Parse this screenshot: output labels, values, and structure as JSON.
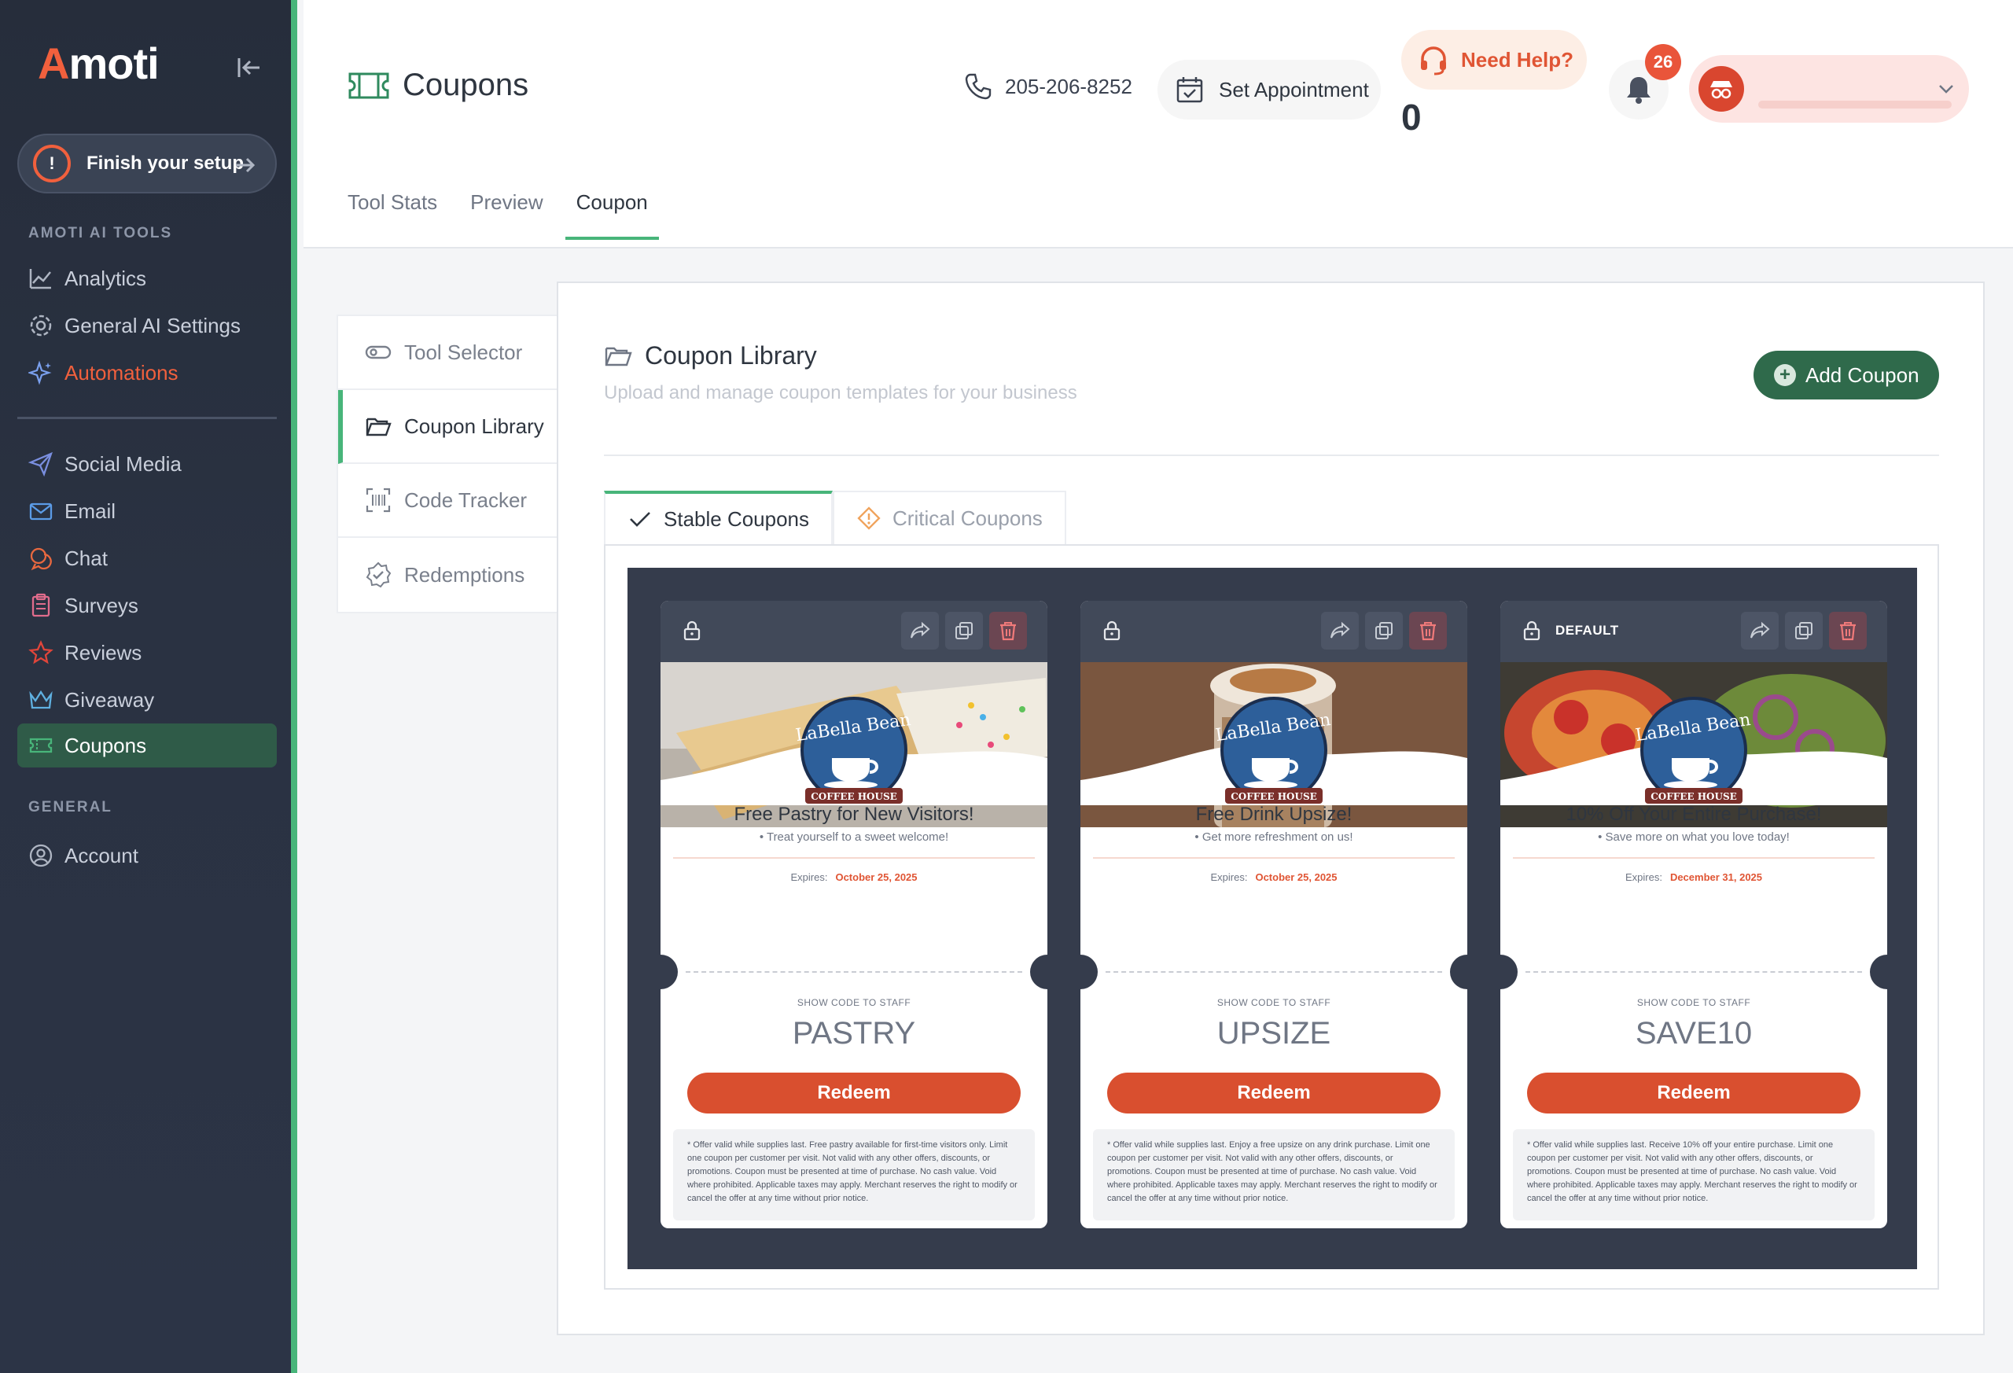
{
  "brand": {
    "logo": "Amoti"
  },
  "sidebar": {
    "setup_label": "Finish your setup",
    "section_tools": "AMOTI AI TOOLS",
    "tools": [
      {
        "label": "Analytics",
        "icon": "chart-line-icon"
      },
      {
        "label": "General AI Settings",
        "icon": "gear-icon"
      },
      {
        "label": "Automations",
        "icon": "sparkle-icon"
      }
    ],
    "items": [
      {
        "label": "Social Media",
        "icon": "send-icon"
      },
      {
        "label": "Email",
        "icon": "mail-icon"
      },
      {
        "label": "Chat",
        "icon": "chat-icon"
      },
      {
        "label": "Surveys",
        "icon": "clipboard-icon"
      },
      {
        "label": "Reviews",
        "icon": "star-icon"
      },
      {
        "label": "Giveaway",
        "icon": "crown-icon"
      },
      {
        "label": "Coupons",
        "icon": "ticket-icon"
      }
    ],
    "section_general": "GENERAL",
    "account": "Account"
  },
  "header": {
    "title": "Coupons",
    "phone": "205-206-8252",
    "appointment": "Set Appointment",
    "help": "Need Help?",
    "help_count": "0",
    "notifications": "26",
    "tabs": [
      "Tool Stats",
      "Preview",
      "Coupon"
    ],
    "active_tab": "Coupon"
  },
  "subnav": {
    "items": [
      "Tool Selector",
      "Coupon Library",
      "Code Tracker",
      "Redemptions"
    ],
    "active": "Coupon Library"
  },
  "library": {
    "title": "Coupon Library",
    "subtitle": "Upload and manage coupon templates for your business",
    "add_button": "Add Coupon",
    "tabs": [
      "Stable Coupons",
      "Critical Coupons"
    ],
    "active_tab": "Stable Coupons"
  },
  "coupons": [
    {
      "default_label": "",
      "title": "Free Pastry for New Visitors!",
      "subtitle": "• Treat yourself to a sweet welcome!",
      "expires_label": "Expires:",
      "expires": "October 25, 2025",
      "show_code": "SHOW CODE TO STAFF",
      "code": "PASTRY",
      "redeem": "Redeem",
      "terms": "* Offer valid while supplies last. Free pastry available for first-time visitors only. Limit one coupon per customer per visit. Not valid with any other offers, discounts, or promotions. Coupon must be presented at time of purchase. No cash value. Void where prohibited. Applicable taxes may apply. Merchant reserves the right to modify or cancel the offer at any time without prior notice."
    },
    {
      "default_label": "",
      "title": "Free Drink Upsize!",
      "subtitle": "• Get more refreshment on us!",
      "expires_label": "Expires:",
      "expires": "October 25, 2025",
      "show_code": "SHOW CODE TO STAFF",
      "code": "UPSIZE",
      "redeem": "Redeem",
      "terms": "* Offer valid while supplies last. Enjoy a free upsize on any drink purchase. Limit one coupon per customer per visit. Not valid with any other offers, discounts, or promotions. Coupon must be presented at time of purchase. No cash value. Void where prohibited. Applicable taxes may apply. Merchant reserves the right to modify or cancel the offer at any time without prior notice."
    },
    {
      "default_label": "DEFAULT",
      "title": "10% Off Your Entire Purchase!",
      "subtitle": "• Save more on what you love today!",
      "expires_label": "Expires:",
      "expires": "December 31, 2025",
      "show_code": "SHOW CODE TO STAFF",
      "code": "SAVE10",
      "redeem": "Redeem",
      "terms": "* Offer valid while supplies last. Receive 10% off your entire purchase. Limit one coupon per customer per visit. Not valid with any other offers, discounts, or promotions. Coupon must be presented at time of purchase. No cash value. Void where prohibited. Applicable taxes may apply. Merchant reserves the right to modify or cancel the offer at any time without prior notice."
    }
  ],
  "emblem": {
    "line1": "LaBella Bean",
    "line2": "COFFEE HOUSE"
  },
  "colors": {
    "accent": "#48b57a",
    "brand_orange": "#f1603d",
    "redeem": "#d94f2f",
    "add_button": "#2f6a4b"
  }
}
